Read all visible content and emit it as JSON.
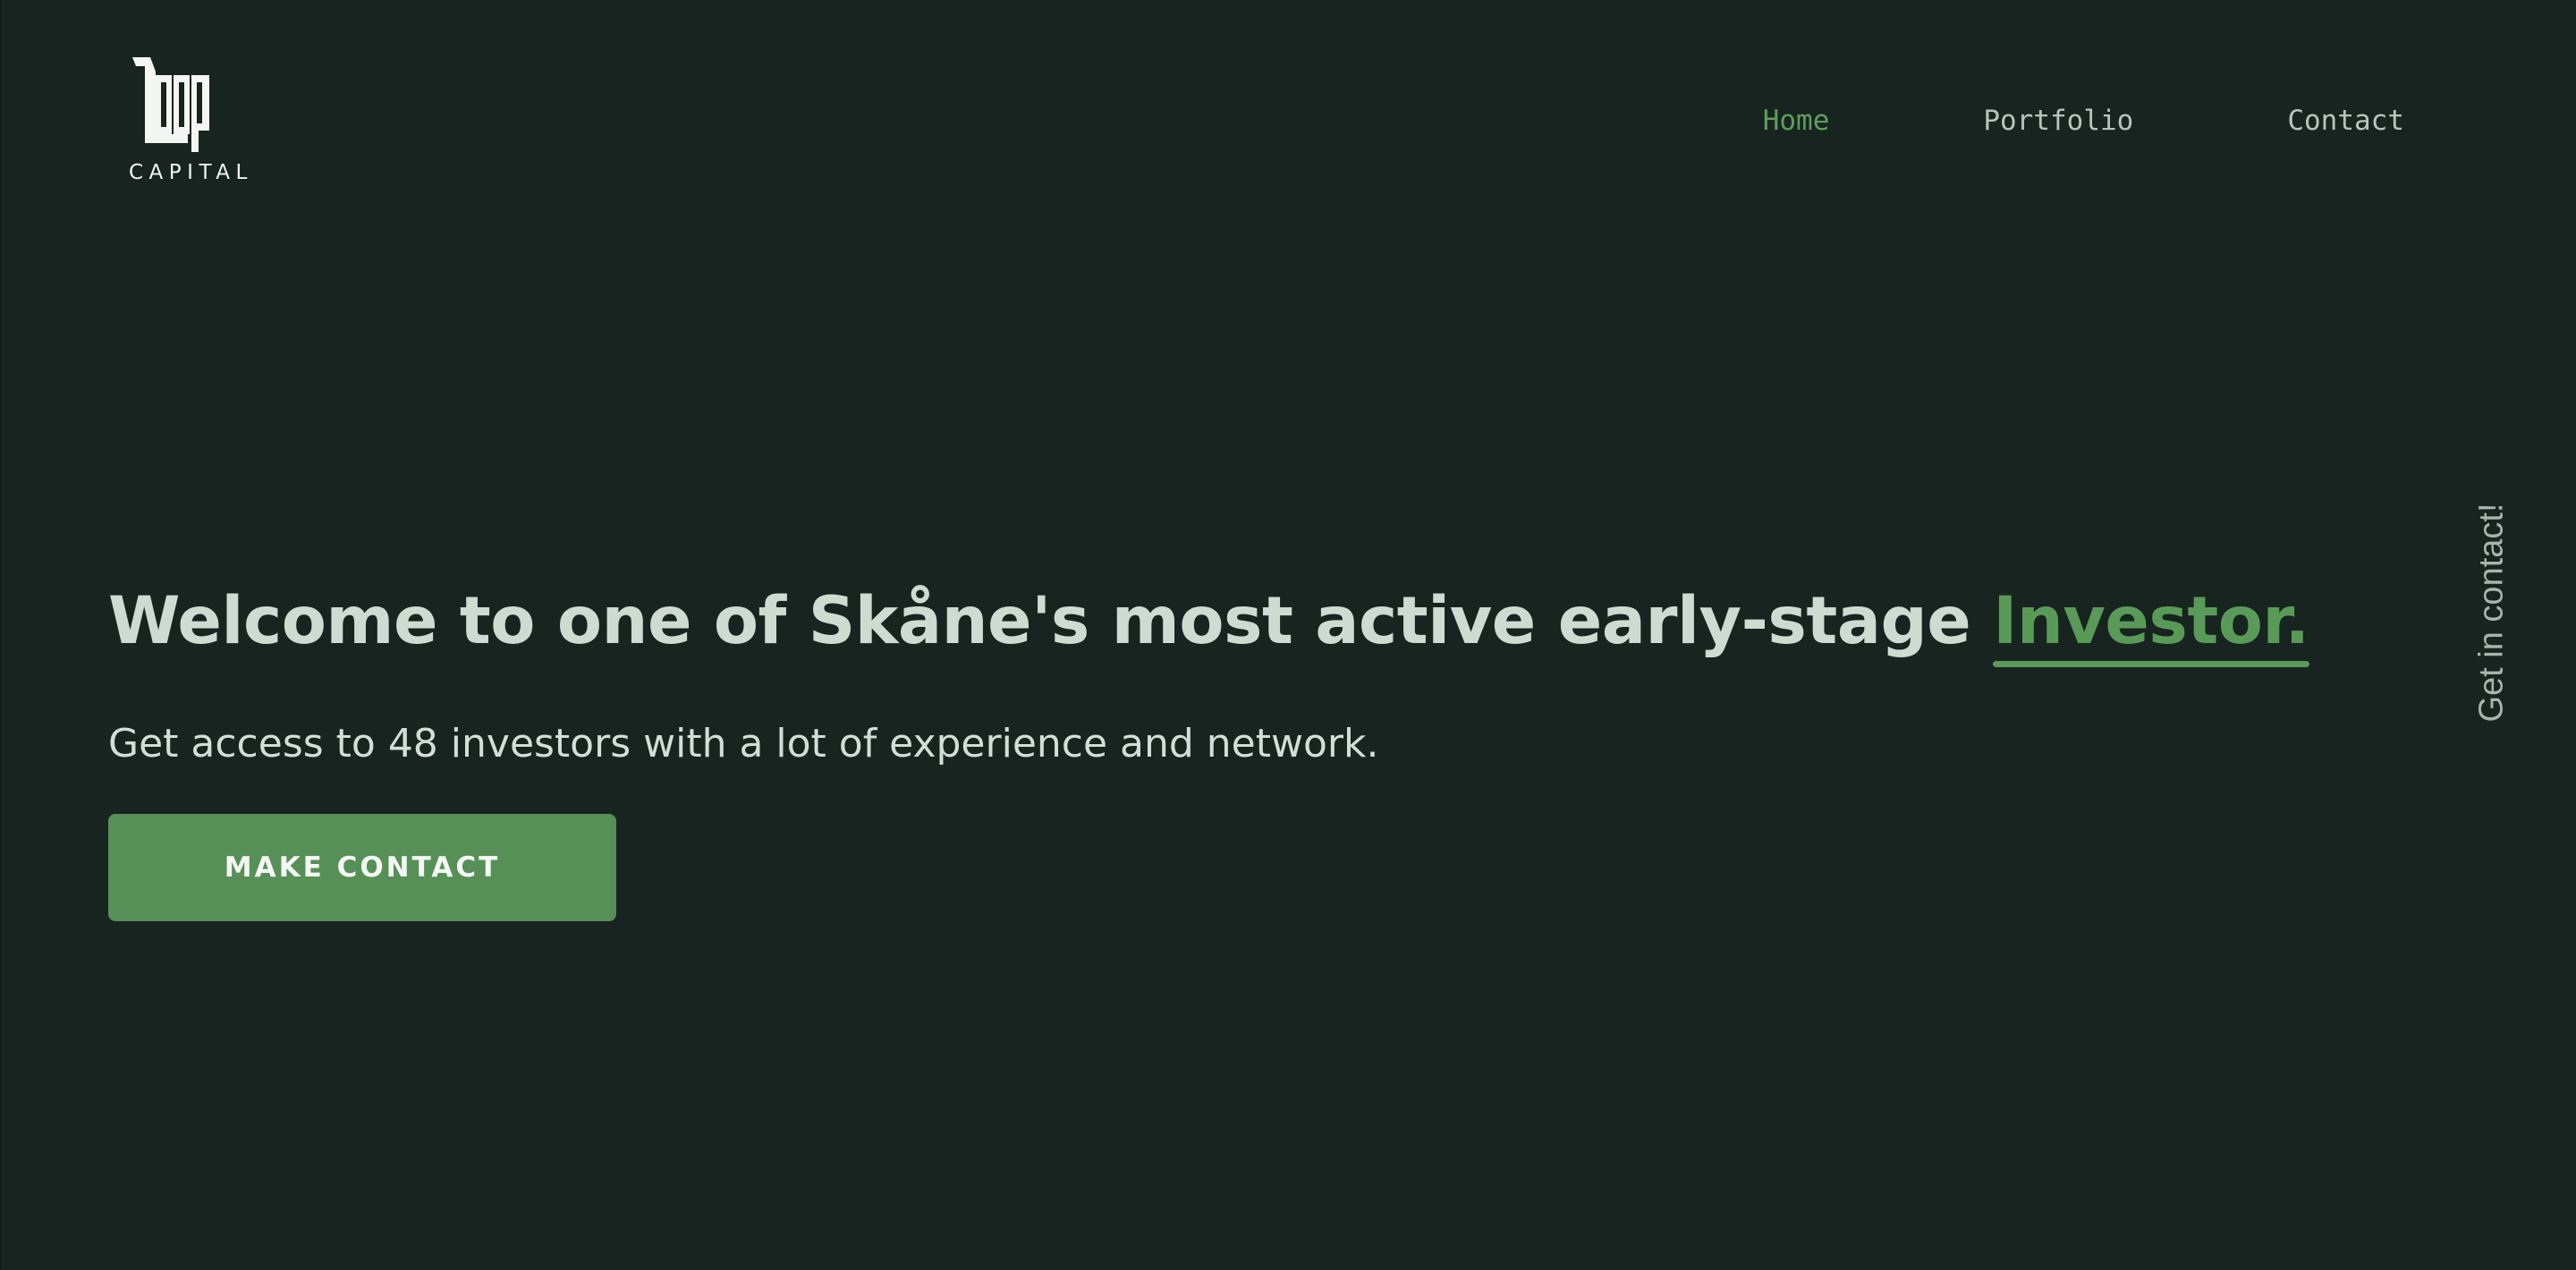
{
  "logo": {
    "wordmark": "loop",
    "subtitle": "CAPITAL"
  },
  "nav": {
    "items": [
      {
        "label": "Home",
        "active": true
      },
      {
        "label": "Portfolio",
        "active": false
      },
      {
        "label": "Contact",
        "active": false
      }
    ]
  },
  "hero": {
    "headline_main": "Welcome to one of Skåne's most active early-stage ",
    "headline_accent": "Investor.",
    "subline": "Get access to 48 investors with a lot of experience and network.",
    "cta_label": "MAKE CONTACT"
  },
  "side_link": {
    "label": "Get in contact!"
  },
  "colors": {
    "background": "#182420",
    "accent": "#5a9a58",
    "headline": "#cfdbd1",
    "nav_text": "#b9c4bd",
    "button": "#569057"
  }
}
